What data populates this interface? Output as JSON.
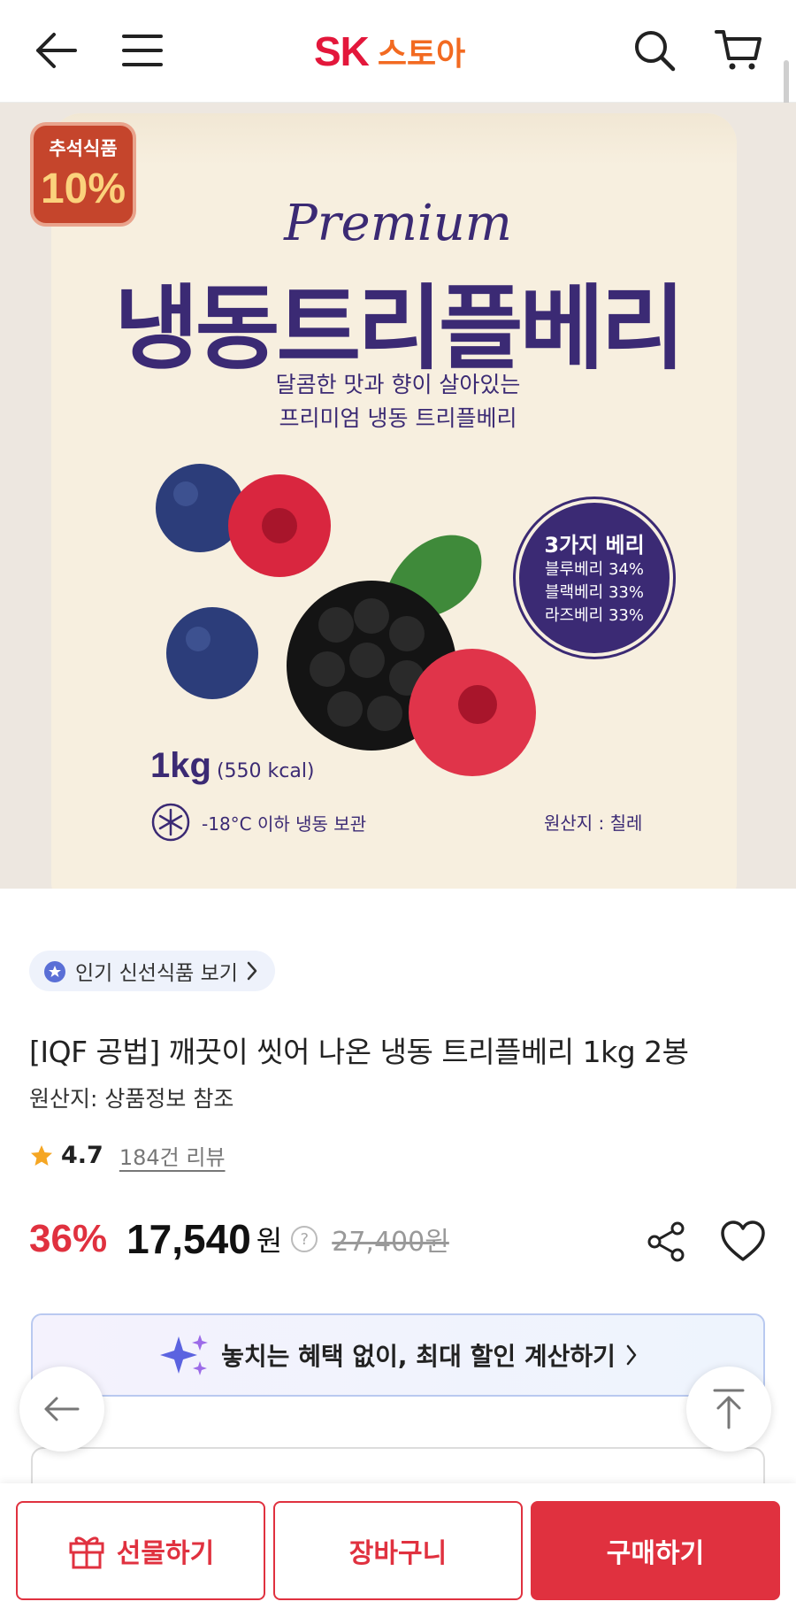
{
  "header": {
    "logo_brand": "SK",
    "logo_store": "스토아"
  },
  "hero": {
    "badge_top": "추석식품",
    "badge_discount": "10%",
    "premium": "Premium",
    "product_title": "냉동트리플베리",
    "sub_line1": "달콤한 맛과 향이 살아있는",
    "sub_line2": "프리미엄 냉동 트리플베리",
    "circle_title": "3가지 베리",
    "circle_lines": [
      "블루베리 34%",
      "블랙베리 33%",
      "라즈베리 33%"
    ],
    "weight": "1kg",
    "kcal": "(550 kcal)",
    "storage": "-18°C 이하 냉동 보관",
    "origin": "원산지 : 칠레"
  },
  "product": {
    "popular_link": "인기 신선식품 보기",
    "name": "[IQF 공법] 깨끗이 씻어 나온 냉동 트리플베리 1kg 2봉",
    "origin": "원산지: 상품정보 참조",
    "rating": "4.7",
    "reviews": "184건 리뷰",
    "discount": "36%",
    "price": "17,540",
    "price_unit": "원",
    "original_price": "27,400원"
  },
  "benefit": {
    "label": "놓치는 혜택 없이, 최대 할인 계산하기"
  },
  "bottom_bar": {
    "gift": "선물하기",
    "cart": "장바구니",
    "buy": "구매하기"
  },
  "colors": {
    "brand_red": "#e0313f",
    "brand_orange": "#f26a21",
    "package_purple": "#3b2a74",
    "star": "#f5a623"
  }
}
